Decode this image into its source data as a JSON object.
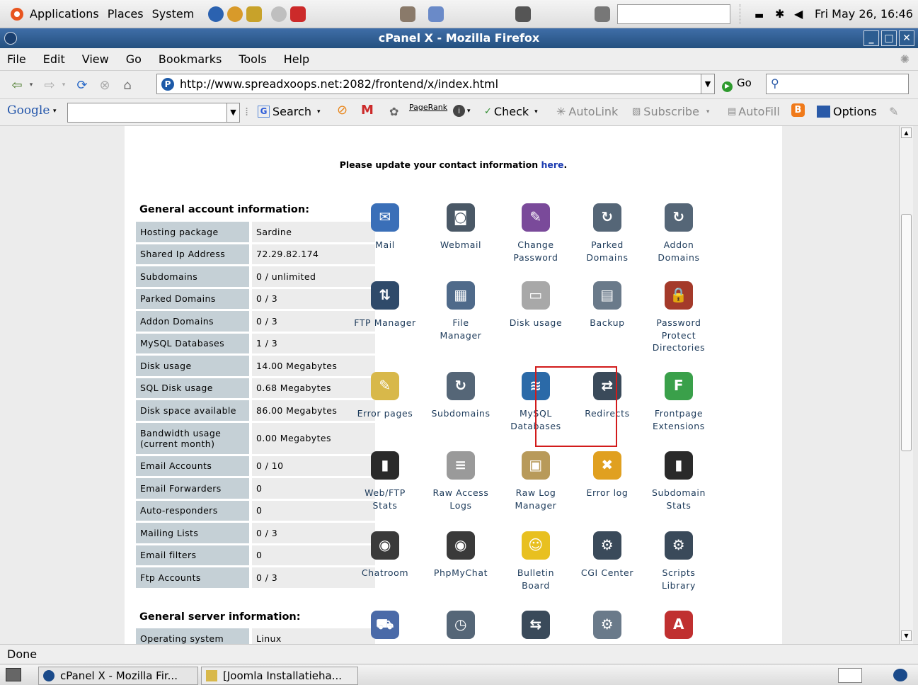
{
  "panel": {
    "menus": [
      "Applications",
      "Places",
      "System"
    ],
    "clock": "Fri May 26, 16:46"
  },
  "window": {
    "title": "cPanel X - Mozilla Firefox"
  },
  "menubar": [
    "File",
    "Edit",
    "View",
    "Go",
    "Bookmarks",
    "Tools",
    "Help"
  ],
  "nav": {
    "url": "http://www.spreadxoops.net:2082/frontend/x/index.html",
    "go_label": "Go"
  },
  "googlebar": {
    "logo": "Google",
    "search_label": "Search",
    "pagerank_label": "PageRank",
    "check_label": "Check",
    "autolink_label": "AutoLink",
    "subscribe_label": "Subscribe",
    "autofill_label": "AutoFill",
    "options_label": "Options"
  },
  "page": {
    "notice_text": "Please update your contact information ",
    "notice_link": "here",
    "notice_end": ".",
    "general_title": "General account information:",
    "server_title": "General server information:",
    "account_rows": [
      {
        "k": "Hosting package",
        "v": "Sardine"
      },
      {
        "k": "Shared Ip Address",
        "v": "72.29.82.174"
      },
      {
        "k": "Subdomains",
        "v": "0 / unlimited"
      },
      {
        "k": "Parked Domains",
        "v": "0 / 3"
      },
      {
        "k": "Addon Domains",
        "v": "0 / 3"
      },
      {
        "k": "MySQL Databases",
        "v": "1 / 3"
      },
      {
        "k": "Disk usage",
        "v": "14.00 Megabytes"
      },
      {
        "k": "SQL Disk usage",
        "v": "0.68 Megabytes"
      },
      {
        "k": "Disk space available",
        "v": "86.00 Megabytes"
      },
      {
        "k": "Bandwidth usage (current month)",
        "v": "0.00 Megabytes"
      },
      {
        "k": "Email Accounts",
        "v": "0 / 10"
      },
      {
        "k": "Email Forwarders",
        "v": "0"
      },
      {
        "k": "Auto-responders",
        "v": "0"
      },
      {
        "k": "Mailing Lists",
        "v": "0 / 3"
      },
      {
        "k": "Email filters",
        "v": "0"
      },
      {
        "k": "Ftp Accounts",
        "v": "0 / 3"
      }
    ],
    "server_rows": [
      {
        "k": "Operating system",
        "v": "Linux"
      }
    ],
    "icons": [
      {
        "label": "Mail",
        "icon": "mail-icon",
        "color": "#3a6fb8"
      },
      {
        "label": "Webmail",
        "icon": "webmail-icon",
        "color": "#4a5866"
      },
      {
        "label": "Change Password",
        "icon": "change-password-icon",
        "color": "#7a4a9a"
      },
      {
        "label": "Parked Domains",
        "icon": "parked-domains-icon",
        "color": "#556677"
      },
      {
        "label": "Addon Domains",
        "icon": "addon-domains-icon",
        "color": "#556677"
      },
      {
        "label": "FTP Manager",
        "icon": "ftp-manager-icon",
        "color": "#2f4a6a"
      },
      {
        "label": "File Manager",
        "icon": "file-manager-icon",
        "color": "#4f6a8a"
      },
      {
        "label": "Disk usage",
        "icon": "disk-usage-icon",
        "color": "#a8a8a8"
      },
      {
        "label": "Backup",
        "icon": "backup-icon",
        "color": "#6a7a8a"
      },
      {
        "label": "Password Protect Directories",
        "icon": "password-protect-icon",
        "color": "#a43a2a"
      },
      {
        "label": "Error pages",
        "icon": "error-pages-icon",
        "color": "#d8b84a"
      },
      {
        "label": "Subdomains",
        "icon": "subdomains-icon",
        "color": "#556677"
      },
      {
        "label": "MySQL Databases",
        "icon": "mysql-icon",
        "color": "#2b6aa8"
      },
      {
        "label": "Redirects",
        "icon": "redirects-icon",
        "color": "#3a4a5a"
      },
      {
        "label": "Frontpage Extensions",
        "icon": "frontpage-icon",
        "color": "#3aa04a"
      },
      {
        "label": "Web/FTP Stats",
        "icon": "web-ftp-stats-icon",
        "color": "#2a2a2a"
      },
      {
        "label": "Raw Access Logs",
        "icon": "raw-access-logs-icon",
        "color": "#9a9a9a"
      },
      {
        "label": "Raw Log Manager",
        "icon": "raw-log-manager-icon",
        "color": "#b89a5a"
      },
      {
        "label": "Error log",
        "icon": "error-log-icon",
        "color": "#e0a020"
      },
      {
        "label": "Subdomain Stats",
        "icon": "subdomain-stats-icon",
        "color": "#2a2a2a"
      },
      {
        "label": "Chatroom",
        "icon": "chatroom-icon",
        "color": "#3a3a3a"
      },
      {
        "label": "PhpMyChat",
        "icon": "phpmychat-icon",
        "color": "#3a3a3a"
      },
      {
        "label": "Bulletin Board",
        "icon": "bulletin-board-icon",
        "color": "#e8c020"
      },
      {
        "label": "CGI Center",
        "icon": "cgi-center-icon",
        "color": "#3a4a5a"
      },
      {
        "label": "Scripts Library",
        "icon": "scripts-library-icon",
        "color": "#3a4a5a"
      },
      {
        "label": "",
        "icon": "shopping-cart-icon",
        "color": "#4a6aa8"
      },
      {
        "label": "",
        "icon": "cron-icon",
        "color": "#556677"
      },
      {
        "label": "",
        "icon": "network-tools-icon",
        "color": "#3a4a5a"
      },
      {
        "label": "",
        "icon": "settings-icon",
        "color": "#6a7a8a"
      },
      {
        "label": "",
        "icon": "apache-icon",
        "color": "#c03030"
      }
    ]
  },
  "statusbar": {
    "text": "Done"
  },
  "taskbar": {
    "tasks": [
      "cPanel X - Mozilla Fir...",
      "[Joomla Installatieha..."
    ]
  }
}
